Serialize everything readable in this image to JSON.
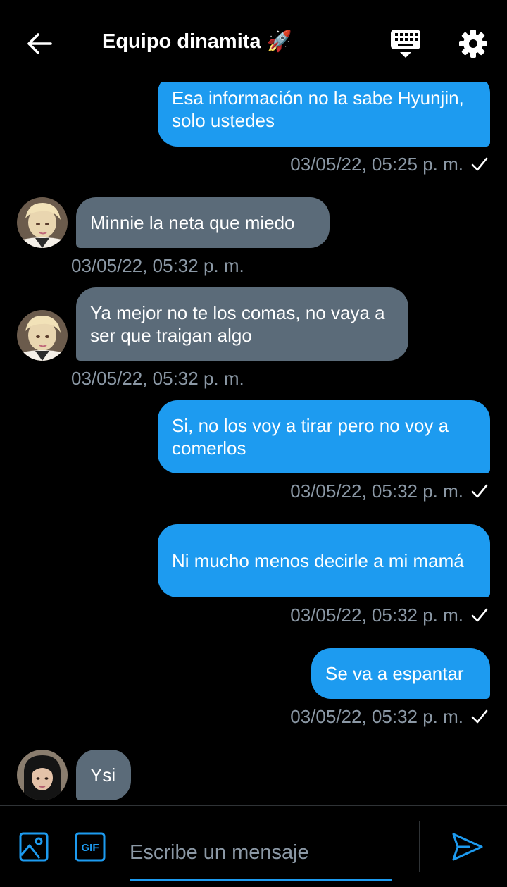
{
  "header": {
    "title": "Equipo dinamita 🚀",
    "back_icon": "arrow-left-icon",
    "keyboard_icon": "keyboard-icon",
    "settings_icon": "gear-icon"
  },
  "messages": [
    {
      "direction": "out",
      "text": "Esa información no la sabe Hyunjin, solo ustedes",
      "time": "03/05/22, 05:25 p. m."
    },
    {
      "direction": "in",
      "text": "Minnie la neta que miedo",
      "time": "03/05/22, 05:32 p. m."
    },
    {
      "direction": "in",
      "text": "Ya mejor no te los comas, no vaya a ser que traigan algo",
      "time": "03/05/22, 05:32 p. m."
    },
    {
      "direction": "out",
      "text": "Si, no los voy a tirar pero no voy a comerlos",
      "time": "03/05/22, 05:32 p. m."
    },
    {
      "direction": "out",
      "text": "Ni mucho menos decirle a mi mamá",
      "time": "03/05/22, 05:32 p. m."
    },
    {
      "direction": "out",
      "text": "Se va a espantar",
      "time": "03/05/22, 05:32 p. m."
    },
    {
      "direction": "in",
      "text": "Ysi",
      "time": ""
    }
  ],
  "composer": {
    "placeholder": "Escribe un mensaje",
    "gif_label": "GIF"
  },
  "colors": {
    "accent": "#1d9bf0",
    "incoming_bubble": "#5b6b79",
    "timestamp": "#8b98a5"
  }
}
